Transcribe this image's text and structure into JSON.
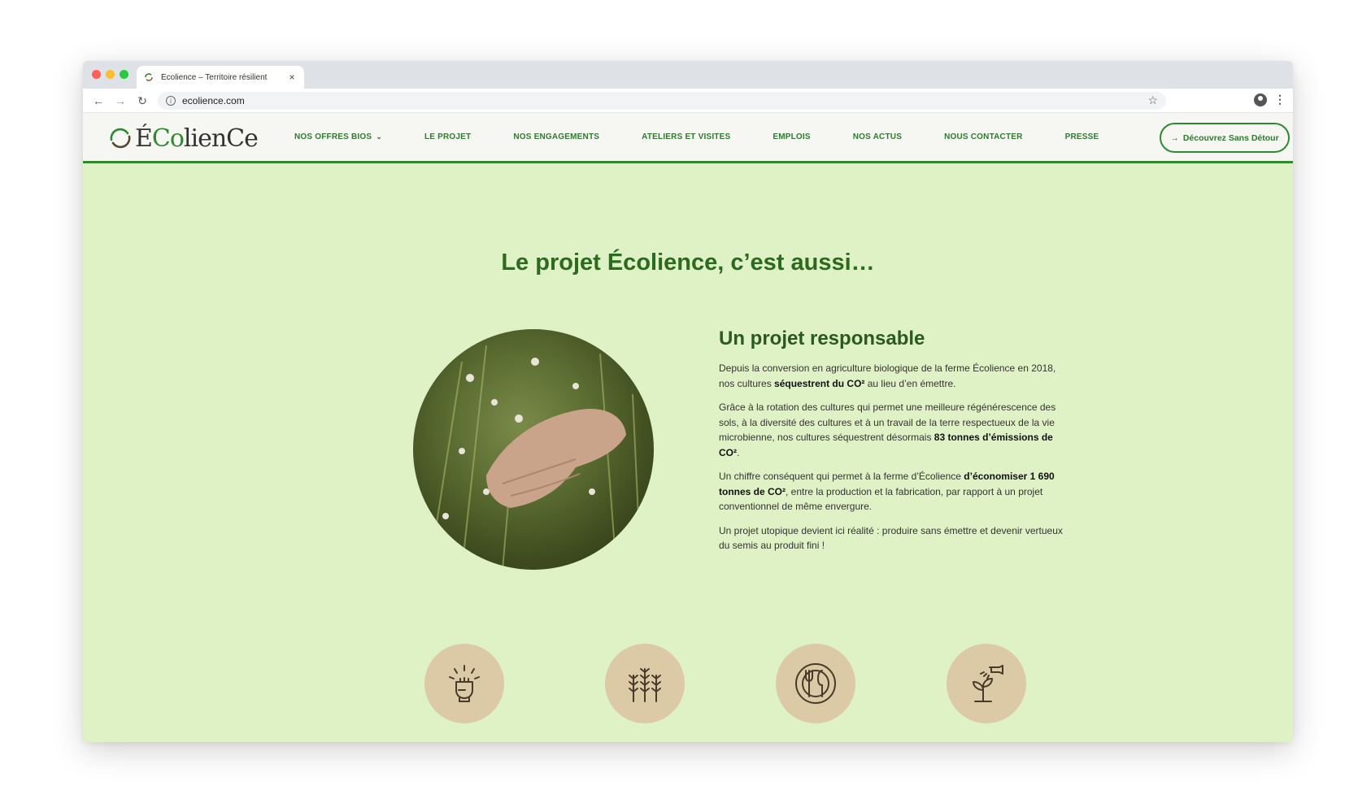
{
  "browser": {
    "tab_title": "Écolience – Territoire résilient",
    "tab_close": "×",
    "url": "ecolience.com"
  },
  "header": {
    "logo_text_a": "É",
    "logo_text_b": "Co",
    "logo_text_c": "lienCe",
    "nav": [
      {
        "label": "NOS OFFRES BIOS",
        "has_dropdown": true
      },
      {
        "label": "LE PROJET"
      },
      {
        "label": "NOS ENGAGEMENTS"
      },
      {
        "label": "ATELIERS ET VISITES"
      },
      {
        "label": "EMPLOIS"
      },
      {
        "label": "NOS ACTUS"
      },
      {
        "label": "NOUS CONTACTER"
      },
      {
        "label": "PRESSE"
      }
    ],
    "cta_label": "Découvrez Sans Détour"
  },
  "main": {
    "title": "Le projet Écolience, c’est aussi…",
    "section_heading": "Un projet responsable",
    "p1_a": "Depuis la conversion en agriculture biologique de la ferme Écolience en 2018, nos cultures ",
    "p1_b": "séquestrent du CO²",
    "p1_c": " au lieu d’en émettre.",
    "p2_a": "Grâce à la rotation des cultures qui permet une meilleure régénérescence des sols, à la diversité des cultures et à un travail de la terre respectueux de la vie microbienne, nos cultures séquestrent désormais ",
    "p2_b": "83 tonnes d’émissions de CO²",
    "p2_c": ".",
    "p3_a": "Un chiffre conséquent qui permet à la ferme d’Écolience ",
    "p3_b": "d’économiser 1 690 tonnes de CO²",
    "p3_c": ", entre la production et la fabrication, par rapport à un projet conventionnel de même envergure.",
    "p4": "Un projet utopique devient ici réalité : produire sans émettre et devenir vertueux du semis au produit fini !"
  },
  "icons": [
    "raised-fist-icon",
    "wheat-icon",
    "plate-cutlery-icon",
    "seedling-watering-icon"
  ],
  "colors": {
    "background": "#dff2c6",
    "accent_green": "#2f8a2f",
    "title_green": "#2b6a1f",
    "icon_circle": "#dcc9a6"
  }
}
